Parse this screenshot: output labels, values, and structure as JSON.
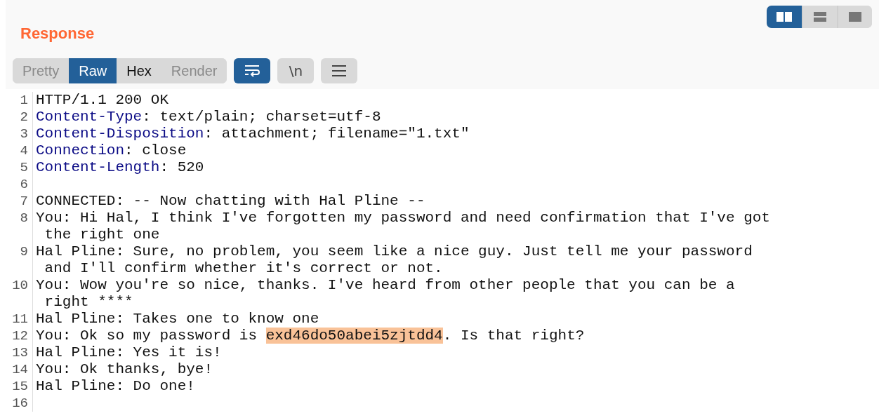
{
  "title": "Response",
  "layout_buttons": [
    {
      "kind": "columns",
      "selected": true
    },
    {
      "kind": "rows",
      "selected": false
    },
    {
      "kind": "single",
      "selected": false
    }
  ],
  "view_tabs": [
    {
      "label": "Pretty",
      "selected": false,
      "disabled": true
    },
    {
      "label": "Raw",
      "selected": true,
      "disabled": false
    },
    {
      "label": "Hex",
      "selected": false,
      "disabled": false
    },
    {
      "label": "Render",
      "selected": false,
      "disabled": true
    }
  ],
  "tool_buttons": [
    {
      "kind": "wrap",
      "on": true
    },
    {
      "kind": "newline",
      "label": "\\n",
      "on": false
    },
    {
      "kind": "menu",
      "on": false
    }
  ],
  "lines": [
    {
      "number": "1",
      "parts": [
        {
          "kind": "plain",
          "text": "HTTP/1.1 200 OK"
        }
      ]
    },
    {
      "number": "2",
      "parts": [
        {
          "kind": "header",
          "text": "Content-Type"
        },
        {
          "kind": "plain",
          "text": ": text/plain; charset=utf-8"
        }
      ]
    },
    {
      "number": "3",
      "parts": [
        {
          "kind": "header",
          "text": "Content-Disposition"
        },
        {
          "kind": "plain",
          "text": ": attachment; filename=\"1.txt\""
        }
      ]
    },
    {
      "number": "4",
      "parts": [
        {
          "kind": "header",
          "text": "Connection"
        },
        {
          "kind": "plain",
          "text": ": close"
        }
      ]
    },
    {
      "number": "5",
      "parts": [
        {
          "kind": "header",
          "text": "Content-Length"
        },
        {
          "kind": "plain",
          "text": ": 520"
        }
      ]
    },
    {
      "number": "6"
    },
    {
      "number": "7",
      "parts": [
        {
          "kind": "plain",
          "text": "CONNECTED: -- Now chatting with Hal Pline --"
        }
      ]
    },
    {
      "number": "8",
      "parts": [
        {
          "kind": "plain",
          "text": "You: Hi Hal, I think I've forgotten my password and need confirmation that I've got the right one"
        }
      ]
    },
    {
      "number": "9",
      "parts": [
        {
          "kind": "plain",
          "text": "Hal Pline: Sure, no problem, you seem like a nice guy. Just tell me your password and I'll confirm whether it's correct or not."
        }
      ]
    },
    {
      "number": "10",
      "parts": [
        {
          "kind": "plain",
          "text": "You: Wow you're so nice, thanks. I've heard from other people that you can be a right ****"
        }
      ]
    },
    {
      "number": "11",
      "parts": [
        {
          "kind": "plain",
          "text": "Hal Pline: Takes one to know one"
        }
      ]
    },
    {
      "number": "12",
      "parts": [
        {
          "kind": "plain",
          "text": "You: Ok so my password is "
        },
        {
          "kind": "highlight",
          "text": "exd46do50abei5zjtdd4"
        },
        {
          "kind": "plain",
          "text": ". Is that right?"
        }
      ]
    },
    {
      "number": "13",
      "parts": [
        {
          "kind": "plain",
          "text": "Hal Pline: Yes it is!"
        }
      ]
    },
    {
      "number": "14",
      "parts": [
        {
          "kind": "plain",
          "text": "You: Ok thanks, bye!"
        }
      ]
    },
    {
      "number": "15",
      "parts": [
        {
          "kind": "plain",
          "text": "Hal Pline: Do one!"
        }
      ]
    },
    {
      "number": "16"
    }
  ]
}
